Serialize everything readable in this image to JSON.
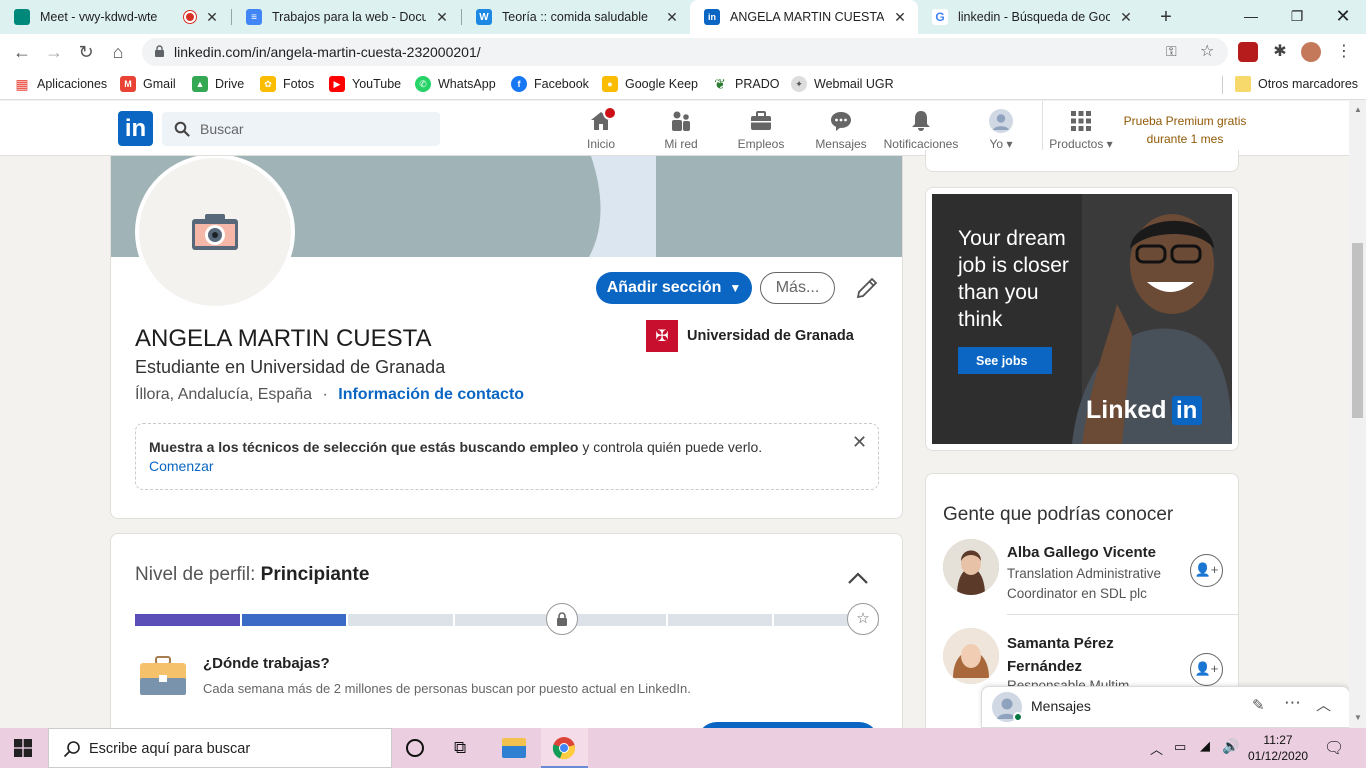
{
  "tabs": [
    {
      "title": "Meet - vwy-kdwd-wte",
      "favicon_color": "#00897b",
      "recording": true
    },
    {
      "title": "Trabajos para la web - Docume",
      "favicon_color": "#4285f4"
    },
    {
      "title": "Teoría :: comida saludable",
      "favicon_color": "#1e88e5",
      "favicon_letter": "W"
    },
    {
      "title": "ANGELA MARTIN CUESTA | Lin",
      "favicon_color": "#0a66c2",
      "favicon_letter": "in",
      "active": true
    },
    {
      "title": "linkedin - Búsqueda de Google",
      "favicon_color": "#ffffff"
    }
  ],
  "address": {
    "url": "linkedin.com/in/angela-martin-cuesta-232000201/"
  },
  "bookmarks": [
    {
      "label": "Aplicaciones",
      "color": "#e94235"
    },
    {
      "label": "Gmail",
      "color": "#ea4335"
    },
    {
      "label": "Drive",
      "color": "#34a853"
    },
    {
      "label": "Fotos",
      "color": "#fbbc04"
    },
    {
      "label": "YouTube",
      "color": "#ff0000"
    },
    {
      "label": "WhatsApp",
      "color": "#25d366"
    },
    {
      "label": "Facebook",
      "color": "#1877f2"
    },
    {
      "label": "Google Keep",
      "color": "#fbbc04"
    },
    {
      "label": "PRADO",
      "color": "#2e7d32"
    },
    {
      "label": "Webmail UGR",
      "color": "#777777"
    }
  ],
  "other_bookmarks": "Otros marcadores",
  "linkedin": {
    "logo": "in",
    "search_placeholder": "Buscar",
    "nav": [
      {
        "label": "Inicio",
        "icon": "home-icon",
        "badge": true
      },
      {
        "label": "Mi red",
        "icon": "network-icon"
      },
      {
        "label": "Empleos",
        "icon": "briefcase-icon"
      },
      {
        "label": "Mensajes",
        "icon": "messaging-icon"
      },
      {
        "label": "Notificaciones",
        "icon": "bell-icon"
      },
      {
        "label": "Yo",
        "icon": "avatar-icon"
      },
      {
        "label": "Productos",
        "icon": "grid-icon"
      }
    ],
    "premium_line1": "Prueba Premium gratis",
    "premium_line2": "durante 1 mes"
  },
  "profile": {
    "name": "ANGELA MARTIN CUESTA",
    "headline": "Estudiante en Universidad de Granada",
    "location": "Íllora, Andalucía, España",
    "separator": "·",
    "contact_link": "Información de contacto",
    "education": "Universidad de Granada",
    "add_section": "Añadir sección",
    "more": "Más...",
    "banner_color": "#a0b4b7",
    "open_to_work": {
      "bold": "Muestra a los técnicos de selección que estás buscando empleo",
      "rest": " y controla quién puede verlo.",
      "link": "Comenzar"
    }
  },
  "strength": {
    "label": "Nivel de perfil:",
    "level": "Principiante",
    "segments_filled": 2,
    "segments_total": 7,
    "question": "¿Dónde trabajas?",
    "description": "Cada semana más de 2 millones de personas buscan por puesto actual en LinkedIn."
  },
  "ad": {
    "line1": "Your dream",
    "line2": "job is closer",
    "line3": "than you",
    "line4": "think",
    "button": "See jobs",
    "brand": "Linked",
    "brand_box": "in"
  },
  "people": {
    "title": "Gente que podrías conocer",
    "items": [
      {
        "name": "Alba Gallego Vicente",
        "subtitle1": "Translation Administrative",
        "subtitle2": "Coordinator en SDL plc"
      },
      {
        "name": "Samanta Pérez",
        "name2": "Fernández",
        "subtitle1": "Responsable Multim..."
      }
    ]
  },
  "messaging": {
    "label": "Mensajes"
  },
  "taskbar": {
    "search_placeholder": "Escribe aquí para buscar",
    "time": "11:27",
    "date": "01/12/2020"
  }
}
